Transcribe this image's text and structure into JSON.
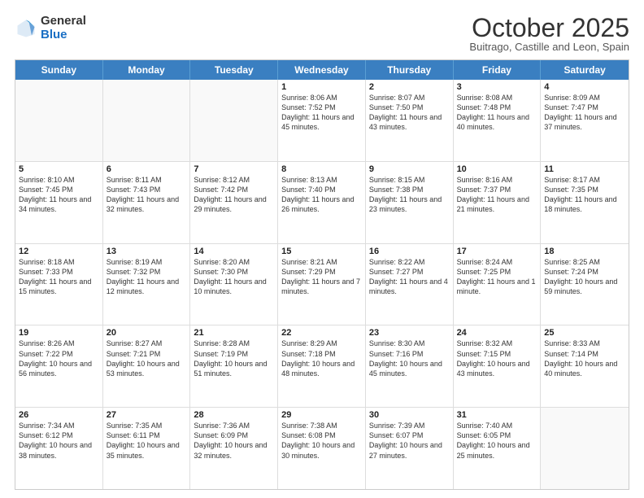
{
  "header": {
    "logo_general": "General",
    "logo_blue": "Blue",
    "month_title": "October 2025",
    "location": "Buitrago, Castille and Leon, Spain"
  },
  "weekdays": [
    "Sunday",
    "Monday",
    "Tuesday",
    "Wednesday",
    "Thursday",
    "Friday",
    "Saturday"
  ],
  "rows": [
    [
      {
        "day": "",
        "text": ""
      },
      {
        "day": "",
        "text": ""
      },
      {
        "day": "",
        "text": ""
      },
      {
        "day": "1",
        "text": "Sunrise: 8:06 AM\nSunset: 7:52 PM\nDaylight: 11 hours and 45 minutes."
      },
      {
        "day": "2",
        "text": "Sunrise: 8:07 AM\nSunset: 7:50 PM\nDaylight: 11 hours and 43 minutes."
      },
      {
        "day": "3",
        "text": "Sunrise: 8:08 AM\nSunset: 7:48 PM\nDaylight: 11 hours and 40 minutes."
      },
      {
        "day": "4",
        "text": "Sunrise: 8:09 AM\nSunset: 7:47 PM\nDaylight: 11 hours and 37 minutes."
      }
    ],
    [
      {
        "day": "5",
        "text": "Sunrise: 8:10 AM\nSunset: 7:45 PM\nDaylight: 11 hours and 34 minutes."
      },
      {
        "day": "6",
        "text": "Sunrise: 8:11 AM\nSunset: 7:43 PM\nDaylight: 11 hours and 32 minutes."
      },
      {
        "day": "7",
        "text": "Sunrise: 8:12 AM\nSunset: 7:42 PM\nDaylight: 11 hours and 29 minutes."
      },
      {
        "day": "8",
        "text": "Sunrise: 8:13 AM\nSunset: 7:40 PM\nDaylight: 11 hours and 26 minutes."
      },
      {
        "day": "9",
        "text": "Sunrise: 8:15 AM\nSunset: 7:38 PM\nDaylight: 11 hours and 23 minutes."
      },
      {
        "day": "10",
        "text": "Sunrise: 8:16 AM\nSunset: 7:37 PM\nDaylight: 11 hours and 21 minutes."
      },
      {
        "day": "11",
        "text": "Sunrise: 8:17 AM\nSunset: 7:35 PM\nDaylight: 11 hours and 18 minutes."
      }
    ],
    [
      {
        "day": "12",
        "text": "Sunrise: 8:18 AM\nSunset: 7:33 PM\nDaylight: 11 hours and 15 minutes."
      },
      {
        "day": "13",
        "text": "Sunrise: 8:19 AM\nSunset: 7:32 PM\nDaylight: 11 hours and 12 minutes."
      },
      {
        "day": "14",
        "text": "Sunrise: 8:20 AM\nSunset: 7:30 PM\nDaylight: 11 hours and 10 minutes."
      },
      {
        "day": "15",
        "text": "Sunrise: 8:21 AM\nSunset: 7:29 PM\nDaylight: 11 hours and 7 minutes."
      },
      {
        "day": "16",
        "text": "Sunrise: 8:22 AM\nSunset: 7:27 PM\nDaylight: 11 hours and 4 minutes."
      },
      {
        "day": "17",
        "text": "Sunrise: 8:24 AM\nSunset: 7:25 PM\nDaylight: 11 hours and 1 minute."
      },
      {
        "day": "18",
        "text": "Sunrise: 8:25 AM\nSunset: 7:24 PM\nDaylight: 10 hours and 59 minutes."
      }
    ],
    [
      {
        "day": "19",
        "text": "Sunrise: 8:26 AM\nSunset: 7:22 PM\nDaylight: 10 hours and 56 minutes."
      },
      {
        "day": "20",
        "text": "Sunrise: 8:27 AM\nSunset: 7:21 PM\nDaylight: 10 hours and 53 minutes."
      },
      {
        "day": "21",
        "text": "Sunrise: 8:28 AM\nSunset: 7:19 PM\nDaylight: 10 hours and 51 minutes."
      },
      {
        "day": "22",
        "text": "Sunrise: 8:29 AM\nSunset: 7:18 PM\nDaylight: 10 hours and 48 minutes."
      },
      {
        "day": "23",
        "text": "Sunrise: 8:30 AM\nSunset: 7:16 PM\nDaylight: 10 hours and 45 minutes."
      },
      {
        "day": "24",
        "text": "Sunrise: 8:32 AM\nSunset: 7:15 PM\nDaylight: 10 hours and 43 minutes."
      },
      {
        "day": "25",
        "text": "Sunrise: 8:33 AM\nSunset: 7:14 PM\nDaylight: 10 hours and 40 minutes."
      }
    ],
    [
      {
        "day": "26",
        "text": "Sunrise: 7:34 AM\nSunset: 6:12 PM\nDaylight: 10 hours and 38 minutes."
      },
      {
        "day": "27",
        "text": "Sunrise: 7:35 AM\nSunset: 6:11 PM\nDaylight: 10 hours and 35 minutes."
      },
      {
        "day": "28",
        "text": "Sunrise: 7:36 AM\nSunset: 6:09 PM\nDaylight: 10 hours and 32 minutes."
      },
      {
        "day": "29",
        "text": "Sunrise: 7:38 AM\nSunset: 6:08 PM\nDaylight: 10 hours and 30 minutes."
      },
      {
        "day": "30",
        "text": "Sunrise: 7:39 AM\nSunset: 6:07 PM\nDaylight: 10 hours and 27 minutes."
      },
      {
        "day": "31",
        "text": "Sunrise: 7:40 AM\nSunset: 6:05 PM\nDaylight: 10 hours and 25 minutes."
      },
      {
        "day": "",
        "text": ""
      }
    ]
  ]
}
